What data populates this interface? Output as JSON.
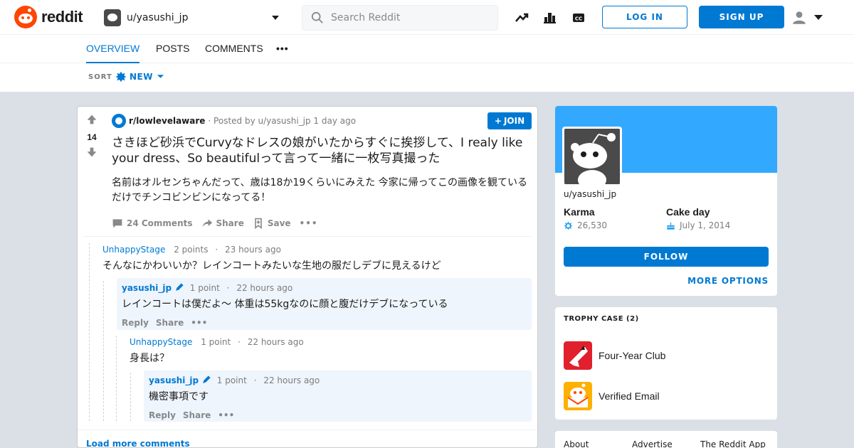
{
  "header": {
    "wordmark": "reddit",
    "user_dropdown_name": "u/yasushi_jp",
    "search_placeholder": "Search Reddit",
    "login_label": "LOG IN",
    "signup_label": "SIGN UP",
    "icons": [
      "popular-icon",
      "stats-icon",
      "captions-icon",
      "user-icon"
    ]
  },
  "tabs": [
    {
      "label": "OVERVIEW",
      "active": true
    },
    {
      "label": "POSTS",
      "active": false
    },
    {
      "label": "COMMENTS",
      "active": false
    }
  ],
  "sort": {
    "label": "SORT",
    "value": "NEW"
  },
  "post": {
    "score": "14",
    "subreddit": "r/lowlevelaware",
    "posted_by": "· Posted by u/yasushi_jp 1 day ago",
    "join_label": "JOIN",
    "title": "さきほど砂浜でCurvyなドレスの娘がいたからすぐに挨拶して、I realy like your dress、So beautifulって言って一緒に一枚写真撮った",
    "body": "名前はオルセンちゃんだって、歳は18か19くらいにみえた 今家に帰ってこの画像を観ているだけでチンコビンビンになってる！",
    "comments_label": "24 Comments",
    "share_label": "Share",
    "save_label": "Save"
  },
  "comments": [
    {
      "author": "UnhappyStage",
      "points": "2 points",
      "time": "23 hours ago",
      "text": "そんなにかわいいか？レインコートみたいな生地の服だしデブに見えるけど"
    },
    {
      "author": "yasushi_jp",
      "points": "1 point",
      "time": "22 hours ago",
      "text": "レインコートは僕だよ〜 体重は55kgなのに顔と腹だけデブになっている",
      "reply": "Reply",
      "share": "Share"
    },
    {
      "author": "UnhappyStage",
      "points": "1 point",
      "time": "22 hours ago",
      "text": "身長は？"
    },
    {
      "author": "yasushi_jp",
      "points": "1 point",
      "time": "22 hours ago",
      "text": "機密事項です",
      "reply": "Reply",
      "share": "Share"
    }
  ],
  "dot_separator": "·",
  "load_more": "Load more comments",
  "profile": {
    "name": "u/yasushi_jp",
    "karma_label": "Karma",
    "karma_value": "26,530",
    "cakeday_label": "Cake day",
    "cakeday_value": "July 1, 2014",
    "follow_label": "FOLLOW",
    "more_options": "MORE OPTIONS",
    "banner_color": "#33a8ff"
  },
  "trophies": {
    "title": "TROPHY CASE (2)",
    "items": [
      {
        "name": "Four-Year Club"
      },
      {
        "name": "Verified Email"
      }
    ]
  },
  "footer": {
    "links": [
      "About",
      "Advertise",
      "The Reddit App"
    ]
  },
  "colors": {
    "accent": "#0079d3",
    "brand": "#ff4500",
    "background": "#dae0e6"
  }
}
